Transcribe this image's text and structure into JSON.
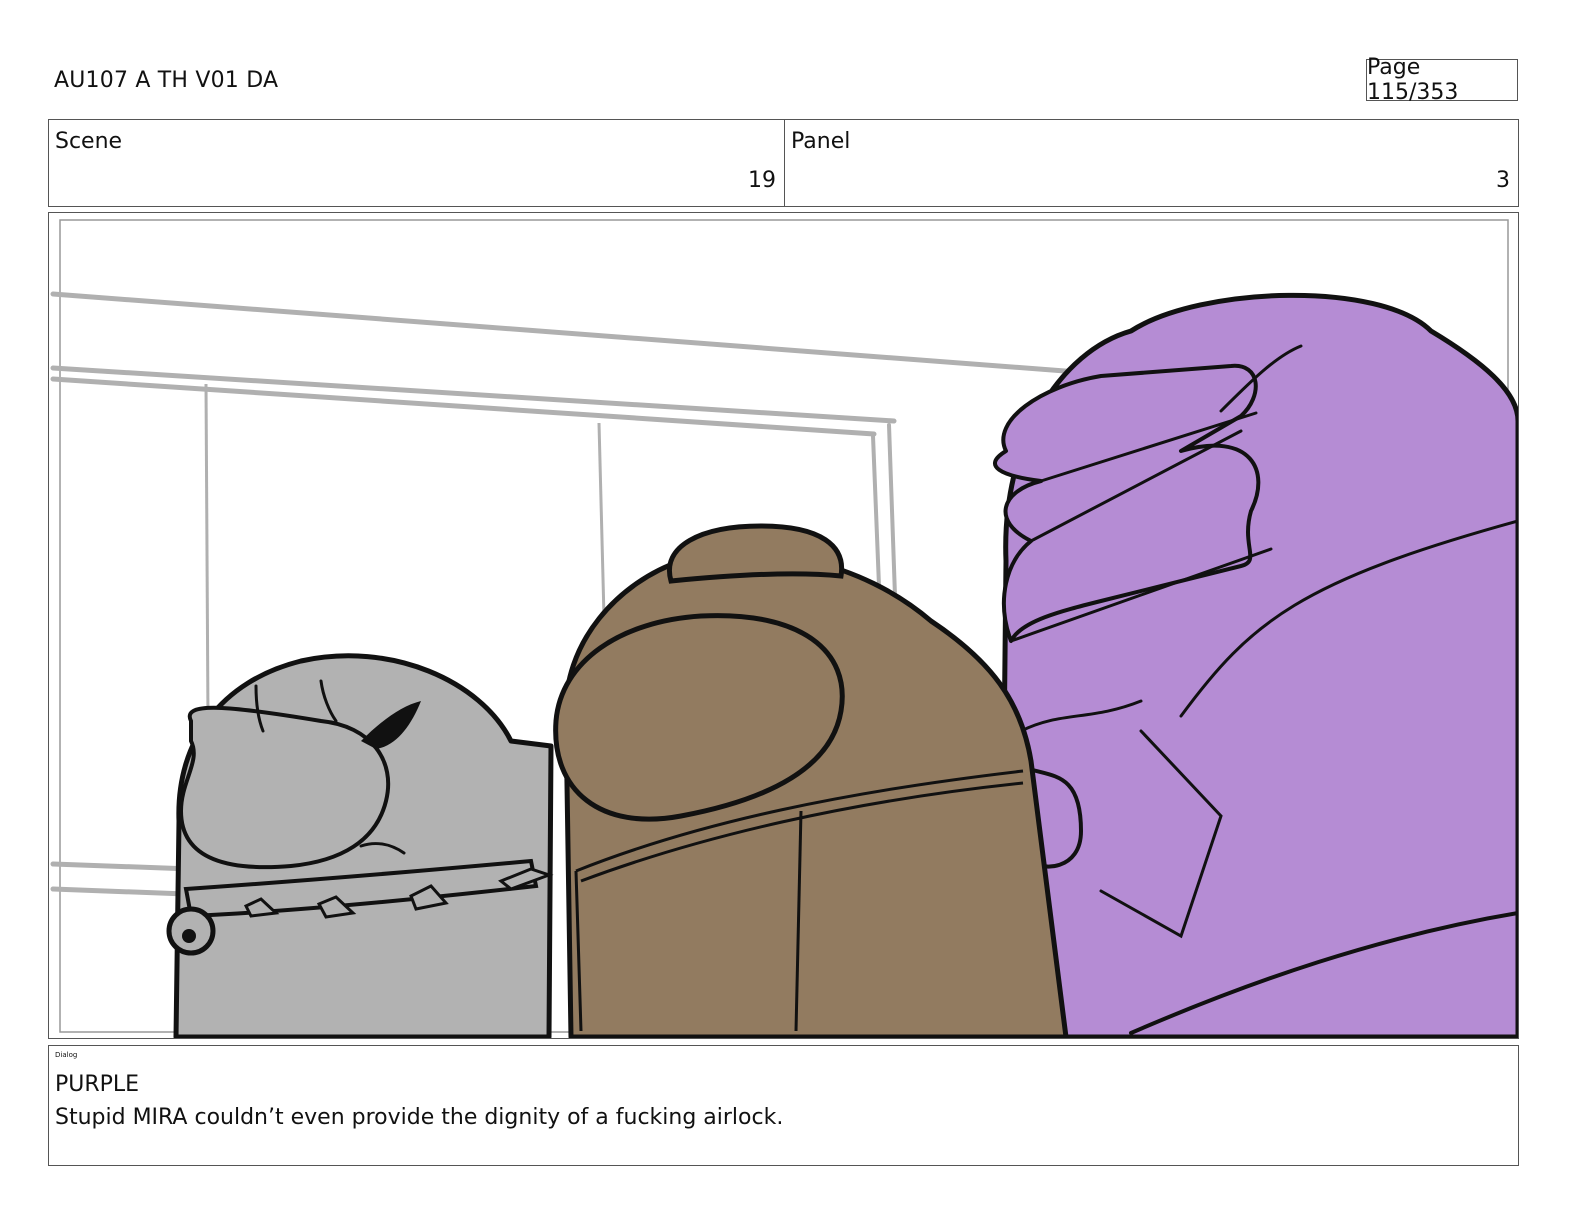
{
  "header": {
    "title": "AU107 A TH V01 DA",
    "page": "Page 115/353"
  },
  "info": {
    "scene_label": "Scene",
    "scene_value": "19",
    "panel_label": "Panel",
    "panel_value": "3"
  },
  "artwork": {
    "colors": {
      "gray_crewmate": "#b2b2b2",
      "brown_crewmate": "#927b60",
      "purple_crewmate": "#b58cd4",
      "lines": "#111111",
      "window_frame": "#b0b0b0"
    }
  },
  "dialog": {
    "tag": "Dialog",
    "character": "PURPLE",
    "line": "Stupid MIRA couldn’t even provide the dignity of a fucking airlock."
  }
}
